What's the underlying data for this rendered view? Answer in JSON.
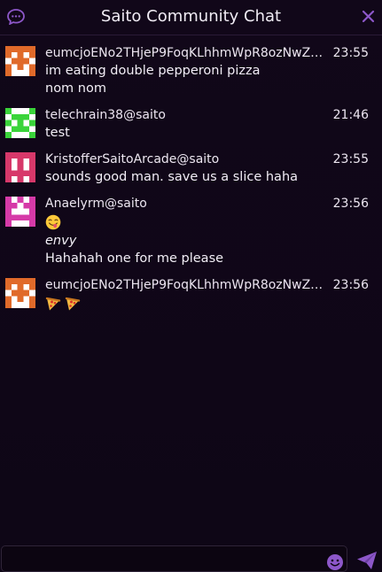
{
  "header": {
    "title": "Saito Community Chat",
    "icon": "chat-bubble-icon",
    "close_icon": "close-icon",
    "accent": "#8d57c9"
  },
  "messages": [
    {
      "username": "eumcjoENo2THjeP9FoqKLhhmWpR8ozNwZo...",
      "time": "23:55",
      "avatar_color": "#e06a2a",
      "lines": [
        "im eating double pepperoni pizza",
        "nom nom"
      ]
    },
    {
      "username": "telechrain38@saito",
      "time": "21:46",
      "avatar_color": "#3ad43a",
      "lines": [
        "test"
      ]
    },
    {
      "username": "KristofferSaitoArcade@saito",
      "time": "23:55",
      "avatar_color": "#d7386a",
      "lines": [
        "sounds good man. save us a slice haha"
      ]
    },
    {
      "username": "Anaelyrm@saito",
      "time": "23:56",
      "avatar_color": "#d63aa8",
      "emoji": "face-savoring-food-emoji",
      "italic_line": "envy",
      "lines": [
        "Hahahah one for me please"
      ]
    },
    {
      "username": "eumcjoENo2THjeP9FoqKLhhmWpR8ozNwZo...",
      "time": "23:56",
      "avatar_color": "#e06a2a",
      "emojis": [
        "pizza-emoji",
        "pizza-emoji"
      ]
    }
  ],
  "input": {
    "placeholder": "",
    "value": "",
    "emoji_picker_icon": "smiley-icon",
    "send_icon": "paper-plane-icon"
  }
}
